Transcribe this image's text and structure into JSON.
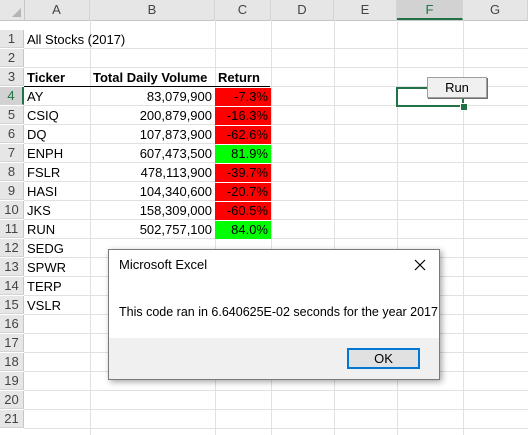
{
  "columns": [
    "A",
    "B",
    "C",
    "D",
    "E",
    "F",
    "G"
  ],
  "rows": [
    "1",
    "2",
    "3",
    "4",
    "5",
    "6",
    "7",
    "8",
    "9",
    "10",
    "11",
    "12",
    "13",
    "14",
    "15",
    "16",
    "17",
    "18",
    "19",
    "20",
    "21"
  ],
  "sheet": {
    "title": "All Stocks (2017)",
    "headers": {
      "ticker": "Ticker",
      "volume": "Total Daily Volume",
      "return": "Return"
    },
    "data": [
      {
        "ticker": "AY",
        "volume": "83,079,900",
        "return": "-7.3%",
        "status": "negative"
      },
      {
        "ticker": "CSIQ",
        "volume": "200,879,900",
        "return": "-16.3%",
        "status": "negative"
      },
      {
        "ticker": "DQ",
        "volume": "107,873,900",
        "return": "-62.6%",
        "status": "negative"
      },
      {
        "ticker": "ENPH",
        "volume": "607,473,500",
        "return": "81.9%",
        "status": "positive"
      },
      {
        "ticker": "FSLR",
        "volume": "478,113,900",
        "return": "-39.7%",
        "status": "negative"
      },
      {
        "ticker": "HASI",
        "volume": "104,340,600",
        "return": "-20.7%",
        "status": "negative"
      },
      {
        "ticker": "JKS",
        "volume": "158,309,000",
        "return": "-60.5%",
        "status": "negative"
      },
      {
        "ticker": "RUN",
        "volume": "502,757,100",
        "return": "84.0%",
        "status": "positive"
      }
    ],
    "more_tickers": [
      "SEDG",
      "SPWR",
      "TERP",
      "VSLR"
    ]
  },
  "selected_cell": "F4",
  "run_button_label": "Run",
  "dialog": {
    "title": "Microsoft Excel",
    "message": "This code ran in 6.640625E-02 seconds for the year 2017",
    "ok_label": "OK"
  },
  "colors": {
    "negative_fill": "#ff0000",
    "positive_fill": "#00ff00",
    "selection": "#217346",
    "dialog_focus": "#0078d7"
  },
  "icons": {
    "dialog_close": "close-icon"
  }
}
